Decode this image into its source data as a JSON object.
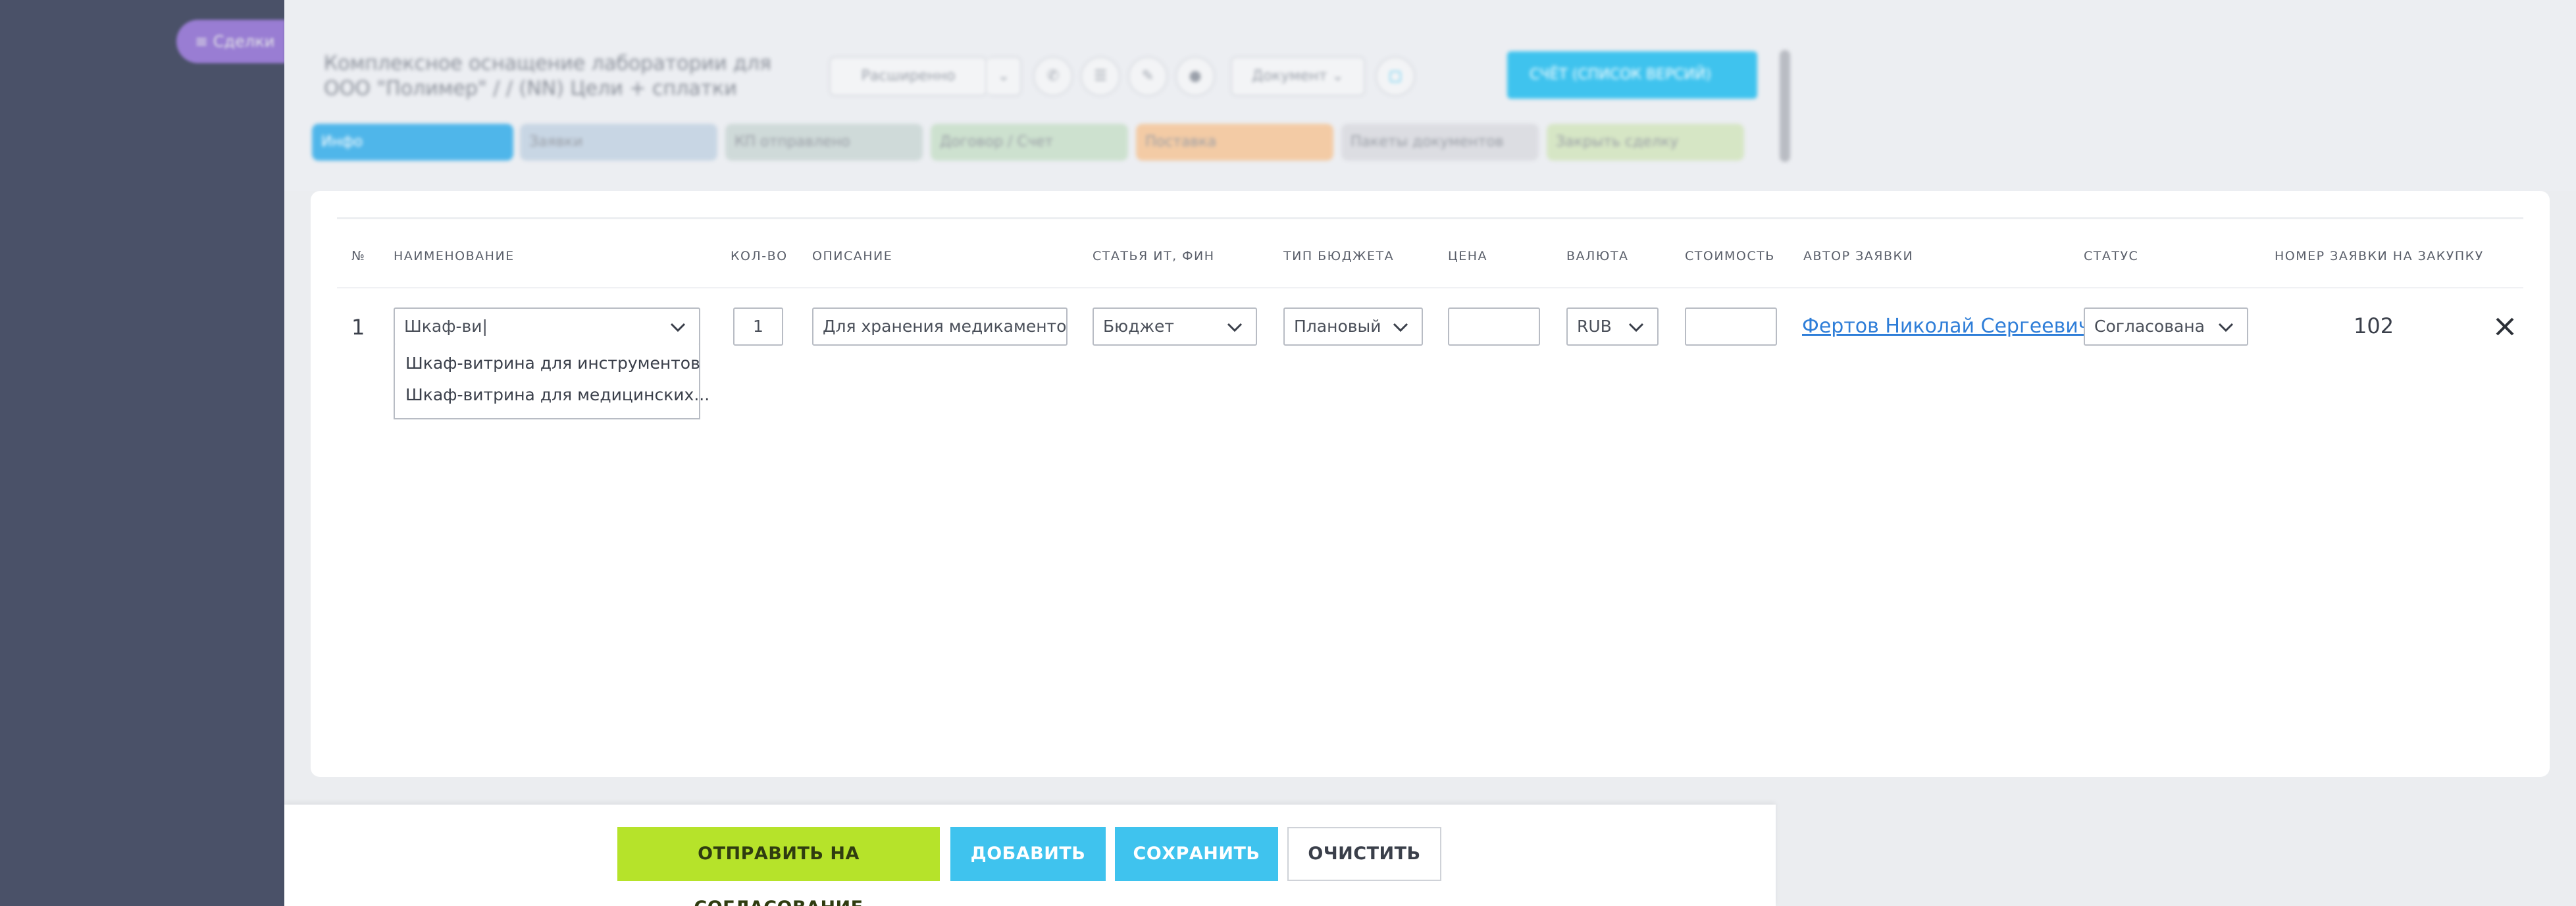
{
  "sidebar": {
    "pill_label": "≡ Сделки"
  },
  "topbar": {
    "title": "Комплексное оснащение лаборатории для ООО \"Полимер\" / / (NN) Цели + сплатки",
    "controls": [
      "Расширенно",
      "⌄",
      "✆",
      "☰",
      "✎",
      "●",
      "Документ ⌄",
      "▢"
    ],
    "action_button": "СЧЁТ (СПИСОК ВЕРСИЙ)",
    "tabs": [
      "Инфо",
      "Заявки",
      "КП отправлено",
      "Договор / Счет",
      "Поставка",
      "Пакеты документов",
      "Закрыть сделку"
    ],
    "tab_colors": [
      "#4fb6ea",
      "#c8d6e4",
      "#cfdad9",
      "#cde1cf",
      "#f3cba5",
      "#dcdde2",
      "#d6e6c5"
    ]
  },
  "table": {
    "headers": {
      "num": "№",
      "name": "НАИМЕНОВАНИЕ",
      "qty": "КОЛ-ВО",
      "desc": "ОПИСАНИЕ",
      "article": "СТАТЬЯ ИТ, ФИН",
      "budget_type": "ТИП БЮДЖЕТА",
      "price": "ЦЕНА",
      "currency": "ВАЛЮТА",
      "cost": "СТОИМОСТЬ",
      "author": "АВТОР ЗАЯВКИ",
      "status": "СТАТУС",
      "request_number": "НОМЕР ЗАЯВКИ НА ЗАКУПКУ"
    },
    "row": {
      "num": "1",
      "name_value": "Шкаф-ви|",
      "suggestions": [
        "Шкаф-витрина для инструментов",
        "Шкаф-витрина для медицинских..."
      ],
      "qty": "1",
      "desc": "Для хранения медикаментов,...",
      "article": "Бюджет",
      "budget_type": "Плановый",
      "price": "",
      "currency": "RUB",
      "cost": "",
      "author": "Фертов Николай Сергеевич",
      "status": "Согласована",
      "request_number": "102"
    }
  },
  "footer": {
    "send": "ОТПРАВИТЬ НА СОГЛАСОВАНИЕ",
    "add": "ДОБАВИТЬ",
    "save": "СОХРАНИТЬ",
    "clear": "ОЧИСТИТЬ"
  },
  "colors": {
    "accent_blue": "#3fc3ee",
    "accent_green": "#b6e32a",
    "link": "#2f7ed8",
    "sidebar": "#4a5168"
  }
}
